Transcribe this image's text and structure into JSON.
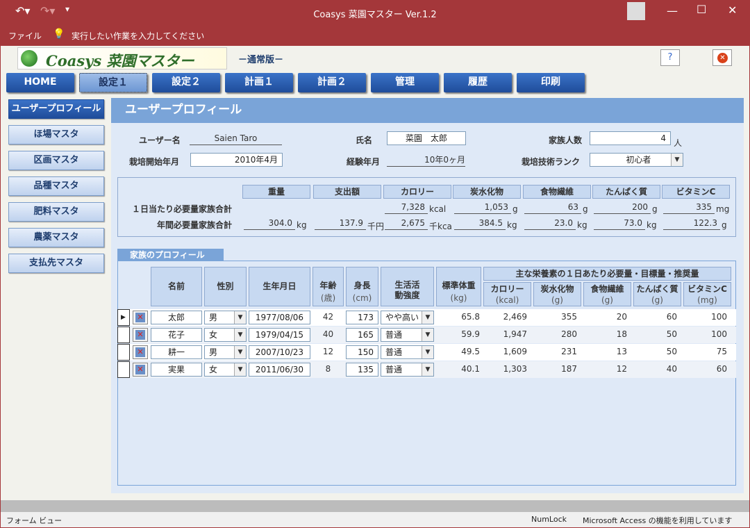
{
  "window": {
    "title": "Coasys 菜園マスター Ver.1.2"
  },
  "ribbon": {
    "file_label": "ファイル",
    "tell_me": "実行したい作業を入力してください"
  },
  "header": {
    "logo_text": "Coasys 菜園マスター",
    "edition": "－通常版－"
  },
  "nav": {
    "tabs": [
      "HOME",
      "設定１",
      "設定２",
      "計画１",
      "計画２",
      "管理",
      "履歴",
      "印刷"
    ],
    "active": "設定１"
  },
  "sidebar": {
    "items": [
      "ユーザープロフィール",
      "ほ場マスタ",
      "区画マスタ",
      "品種マスタ",
      "肥料マスタ",
      "農薬マスタ",
      "支払先マスタ"
    ],
    "active": "ユーザープロフィール"
  },
  "panel": {
    "title": "ユーザープロフィール"
  },
  "user": {
    "user_name_label": "ユーザー名",
    "user_name": "Saien Taro",
    "full_name_label": "氏名",
    "full_name": "菜園　太郎",
    "family_count_label": "家族人数",
    "family_count": "4",
    "family_count_unit": "人",
    "start_label": "栽培開始年月",
    "start": "2010年4月",
    "experience_label": "経験年月",
    "experience": "10年0ヶ月",
    "rank_label": "栽培技術ランク",
    "rank": "初心者"
  },
  "summary": {
    "headers": [
      "重量",
      "支出額",
      "カロリー",
      "炭水化物",
      "食物繊維",
      "たんぱく質",
      "ビタミンC"
    ],
    "daily_label": "１日当たり必要量家族合計",
    "daily": [
      {
        "value": "",
        "unit": ""
      },
      {
        "value": "",
        "unit": ""
      },
      {
        "value": "7,328",
        "unit": "kcal"
      },
      {
        "value": "1,053",
        "unit": "g"
      },
      {
        "value": "63",
        "unit": "g"
      },
      {
        "value": "200",
        "unit": "g"
      },
      {
        "value": "335",
        "unit": "mg"
      }
    ],
    "yearly_label": "年間必要量家族合計",
    "yearly": [
      {
        "value": "304.0",
        "unit": "kg"
      },
      {
        "value": "137.9",
        "unit": "千円"
      },
      {
        "value": "2,675",
        "unit": "千kca"
      },
      {
        "value": "384.5",
        "unit": "kg"
      },
      {
        "value": "23.0",
        "unit": "kg"
      },
      {
        "value": "73.0",
        "unit": "kg"
      },
      {
        "value": "122.3",
        "unit": "g"
      }
    ]
  },
  "family": {
    "tab_label": "家族のプロフィール",
    "group_header": "主な栄養素の１日あたり必要量・目標量・推奨量",
    "col_name": "名前",
    "col_sex": "性別",
    "col_birth": "生年月日",
    "col_age": "年齢",
    "col_age_unit": "(歳)",
    "col_height": "身長",
    "col_height_unit": "(cm)",
    "col_activity": "生活活動強度",
    "col_std_weight": "標準体重",
    "col_std_weight_unit": "(kg)",
    "col_cal": "カロリー",
    "col_cal_unit": "(kcal)",
    "col_carb": "炭水化物",
    "col_carb_unit": "(g)",
    "col_fiber": "食物繊維",
    "col_fiber_unit": "(g)",
    "col_protein": "たんぱく質",
    "col_protein_unit": "(g)",
    "col_vitc": "ビタミンC",
    "col_vitc_unit": "(mg)",
    "rows": [
      {
        "name": "太郎",
        "sex": "男",
        "birth": "1977/08/06",
        "age": "42",
        "height": "173",
        "activity": "やや高い",
        "std_weight": "65.8",
        "cal": "2,469",
        "carb": "355",
        "fiber": "20",
        "protein": "60",
        "vitc": "100"
      },
      {
        "name": "花子",
        "sex": "女",
        "birth": "1979/04/15",
        "age": "40",
        "height": "165",
        "activity": "普通",
        "std_weight": "59.9",
        "cal": "1,947",
        "carb": "280",
        "fiber": "18",
        "protein": "50",
        "vitc": "100"
      },
      {
        "name": "耕一",
        "sex": "男",
        "birth": "2007/10/23",
        "age": "12",
        "height": "150",
        "activity": "普通",
        "std_weight": "49.5",
        "cal": "1,609",
        "carb": "231",
        "fiber": "13",
        "protein": "50",
        "vitc": "75"
      },
      {
        "name": "実果",
        "sex": "女",
        "birth": "2011/06/30",
        "age": "8",
        "height": "135",
        "activity": "普通",
        "std_weight": "40.1",
        "cal": "1,303",
        "carb": "187",
        "fiber": "12",
        "protein": "40",
        "vitc": "60"
      }
    ]
  },
  "status": {
    "left": "フォーム ビュー",
    "numlock": "NumLock",
    "right": "Microsoft Access の機能を利用しています"
  }
}
